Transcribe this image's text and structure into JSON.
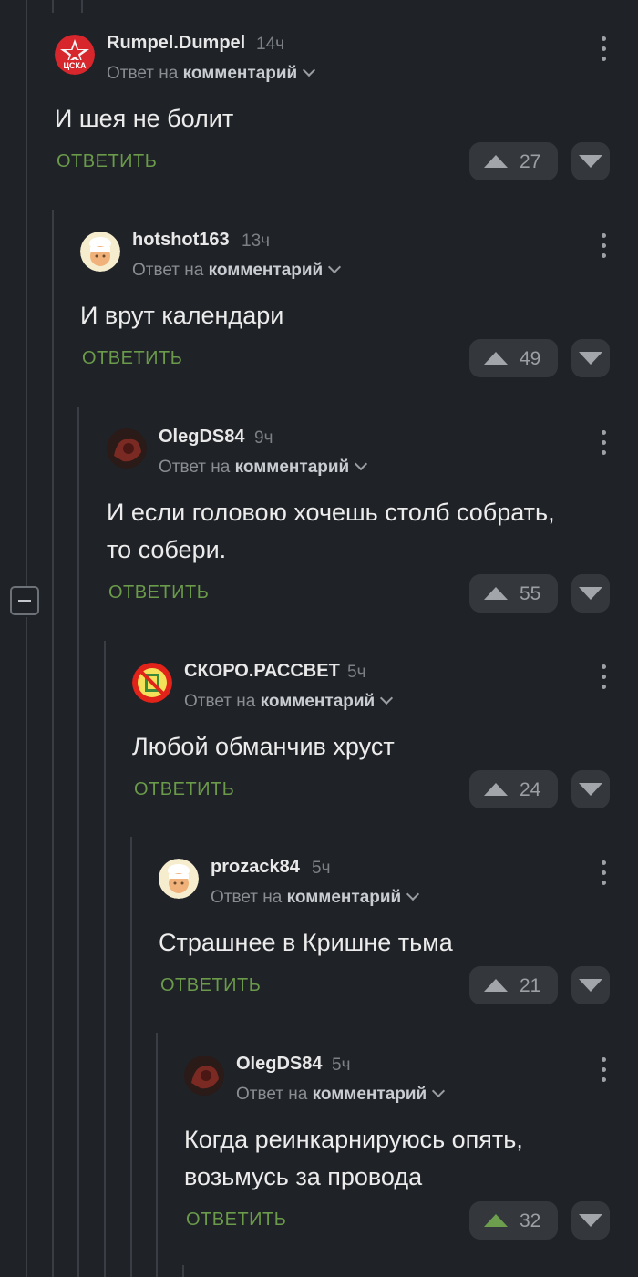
{
  "reply_to_prefix": "Ответ на",
  "reply_to_target": "комментарий",
  "comments": [
    {
      "author": "Rumpel.Dumpel",
      "time": "14ч",
      "text": "И шея не болит",
      "reply_label": "ОТВЕТИТЬ",
      "votes": "27"
    },
    {
      "author": "hotshot163",
      "time": "13ч",
      "text": "И врут календари",
      "reply_label": "ОТВЕТИТЬ",
      "votes": "49"
    },
    {
      "author": "OlegDS84",
      "time": "9ч",
      "text": "И если головою хочешь столб собрать, то собери.",
      "reply_label": "ОТВЕТИТЬ",
      "votes": "55"
    },
    {
      "author": "СКОРО.РАССВЕТ",
      "time": "5ч",
      "text": "Любой обманчив хруст",
      "reply_label": "ОТВЕТИТЬ",
      "votes": "24"
    },
    {
      "author": "prozack84",
      "time": "5ч",
      "text": "Страшнее в Кришне тьма",
      "reply_label": "ОТВЕТИТЬ",
      "votes": "21"
    },
    {
      "author": "OlegDS84",
      "time": "5ч",
      "text": "Когда реинкарнируюсь опять, возьмусь за провода",
      "reply_label": "ОТВЕТИТЬ",
      "votes": "32",
      "upvoted": true
    }
  ],
  "colors": {
    "accent_green": "#6a9a4a",
    "background": "#1f2226",
    "vote_bg": "#34383d"
  },
  "icons": [
    "cska-avatar",
    "chef-avatar",
    "dark-avatar",
    "no-entry-avatar",
    "chevron-down-icon",
    "kebab-menu-icon",
    "upvote-icon",
    "downvote-icon",
    "collapse-icon"
  ]
}
